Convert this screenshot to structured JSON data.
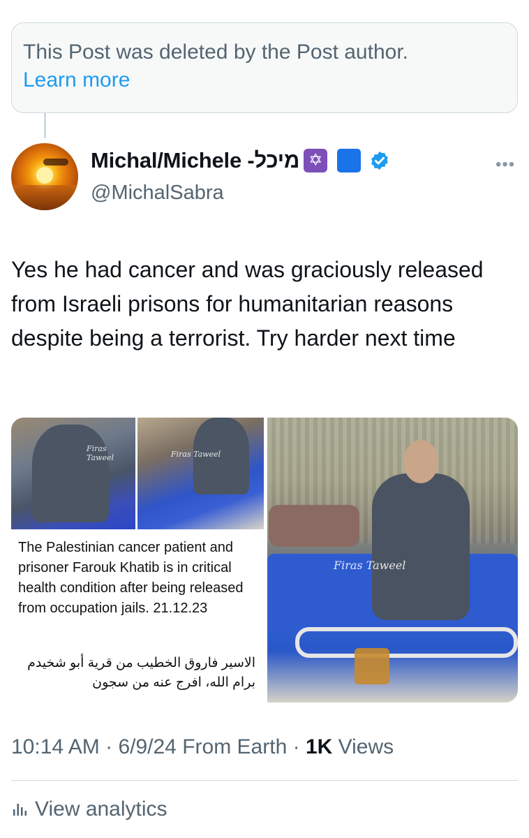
{
  "deleted_notice": {
    "text": "This Post was deleted by the Post author.",
    "link": "Learn more"
  },
  "author": {
    "display_name": "Michal/Michele -מיכל",
    "emoji_star": "✡",
    "handle": "@MichalSabra",
    "verified": true,
    "verified_color": "#1d9bf0"
  },
  "post": {
    "text": "Yes he had cancer and was graciously released from Israeli prisons for humanitarian reasons despite being a terrorist. Try harder next time"
  },
  "media": {
    "caption_en": "The Palestinian cancer patient and prisoner Farouk Khatib is in critical health condition after being released from occupation jails. 21.12.23",
    "caption_ar": "الاسير فاروق الخطيب من قرية أبو شخيدم برام الله، افرج عنه من سجون",
    "watermark": "Firas Taweel"
  },
  "meta": {
    "time": "10:14 AM",
    "date": "6/9/24",
    "source": "From Earth",
    "views_count": "1K",
    "views_label": "Views"
  },
  "analytics": {
    "label": "View analytics"
  },
  "colors": {
    "accent": "#1d9bf0",
    "secondary_text": "#536471",
    "primary_text": "#0f1419"
  }
}
